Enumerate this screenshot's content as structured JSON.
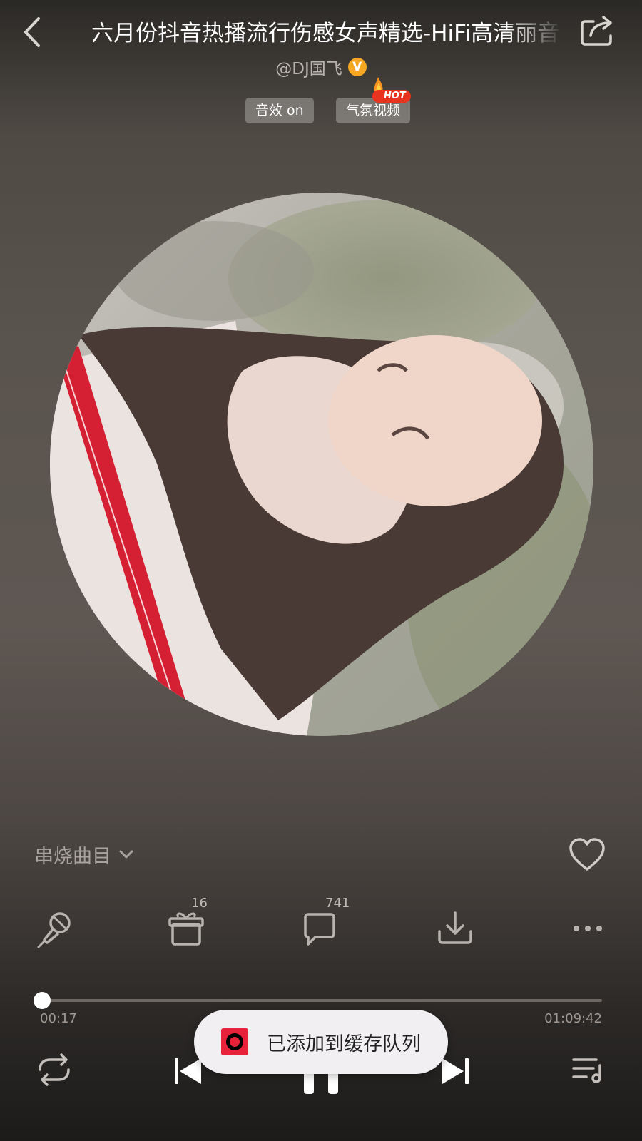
{
  "header": {
    "title": "六月份抖音热播流行伤感女声精选-HiFi高清丽音",
    "artist": "@DJ国飞",
    "vip_mark": "V"
  },
  "chips": {
    "sound_effect": "音效 on",
    "ambient_video": "气氛视频",
    "hot_badge": "HOT"
  },
  "medley": {
    "label": "串烧曲目"
  },
  "actions": {
    "gift_count": "16",
    "comment_count": "741"
  },
  "player": {
    "current_time": "00:17",
    "total_time": "01:09:42",
    "progress_fraction": 0.004
  },
  "toast": {
    "message": "已添加到缓存队列"
  },
  "colors": {
    "accent_red": "#e8223a",
    "vip_orange": "#f5a623",
    "hot_red": "#e8341f"
  }
}
